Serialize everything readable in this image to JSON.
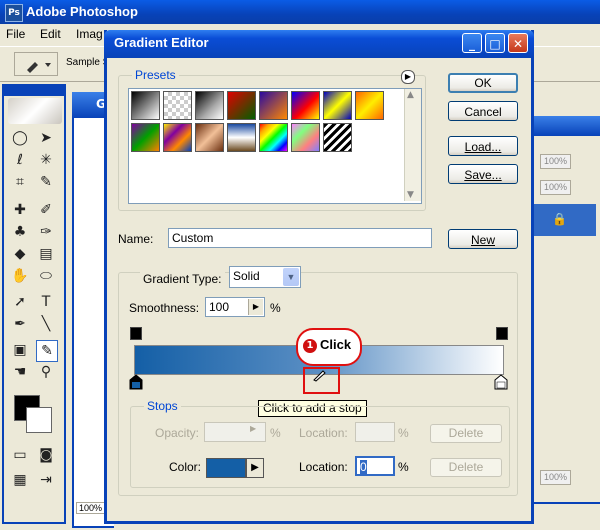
{
  "app": {
    "title": "Adobe Photoshop",
    "logo": "Ps"
  },
  "menu": [
    "File",
    "Edit",
    "Imag"
  ],
  "options_bar": {
    "sample_label": "Sample S"
  },
  "doc_window": {
    "title": "G",
    "zoom": "100%"
  },
  "palette": {
    "fields": [
      "100%",
      "100%",
      "100%"
    ]
  },
  "dialog": {
    "title": "Gradient Editor",
    "title_buttons": {
      "minimize": "_",
      "maximize": "□",
      "close": "✕"
    },
    "presets": {
      "label": "Presets",
      "swatches": [
        {
          "name": "black-white",
          "css": "linear-gradient(135deg,#000,#fff)"
        },
        {
          "name": "transparent-checker",
          "css": "repeating-conic-gradient(#ccc 0 25%,#fff 0 50%) 0 0/8px 8px"
        },
        {
          "name": "black-white-2",
          "css": "linear-gradient(135deg,#000,#aaa 60%,#fff)"
        },
        {
          "name": "red-green",
          "css": "linear-gradient(135deg,#e00000,#006000)"
        },
        {
          "name": "violet-orange",
          "css": "linear-gradient(135deg,#2a0aa0,#ff8800)"
        },
        {
          "name": "blue-red-yellow",
          "css": "linear-gradient(135deg,#0000ff,#ff0000 55%,#ffff00)"
        },
        {
          "name": "blue-yellow-blue",
          "css": "linear-gradient(135deg,#0000c0,#ffff00 50%,#0000c0)"
        },
        {
          "name": "orange-yellow-orange",
          "css": "linear-gradient(135deg,#ff6600,#ffee00 50%,#ff6600)"
        },
        {
          "name": "violet-green-orange",
          "css": "linear-gradient(135deg,#8000a0,#00a000 50%,#ff8000)"
        },
        {
          "name": "yellow-violet-orange-blue",
          "css": "linear-gradient(135deg,#ffee00,#8000a0 35%,#ff8800 65%,#0040c0)"
        },
        {
          "name": "copper",
          "css": "linear-gradient(135deg,#6b2f10,#f2c098 50%,#6b2f10)"
        },
        {
          "name": "chrome",
          "css": "linear-gradient(180deg,#1a4aa0,#fff 50%,#6b4a20)"
        },
        {
          "name": "spectrum",
          "css": "linear-gradient(135deg,red,orange,yellow,lime,cyan,blue,magenta)"
        },
        {
          "name": "transparent-rainbow",
          "css": "linear-gradient(135deg,#ff80ff,#80ff80,#ff8080,#8080ff)"
        },
        {
          "name": "transparent-stripes",
          "css": "repeating-linear-gradient(135deg,#000 0 3px,#fff 3px 6px)"
        }
      ]
    },
    "buttons": {
      "ok": "OK",
      "cancel": "Cancel",
      "load": "Load...",
      "save": "Save...",
      "new": "New"
    },
    "name_label": "Name:",
    "name_value": "Custom",
    "gradient_type_label": "Gradient Type:",
    "gradient_type_value": "Solid",
    "smoothness_label": "Smoothness:",
    "smoothness_value": "100",
    "smoothness_unit": "%",
    "gradient_colors": {
      "start": "#145fa6",
      "mid": "#5b8fc4",
      "end": "#ffffff"
    },
    "annotation": {
      "number": "1",
      "text": "Click"
    },
    "tooltip": "Click to add a stop",
    "stops": {
      "label": "Stops",
      "opacity_label": "Opacity:",
      "opacity_value": "",
      "opacity_unit": "%",
      "location_label_1": "Location:",
      "location_value_1": "",
      "location_unit_1": "%",
      "delete_label_1": "Delete",
      "color_label": "Color:",
      "color_value": "#145fa6",
      "location_label_2": "Location:",
      "location_value_2": "0",
      "location_unit_2": "%",
      "delete_label_2": "Delete"
    }
  }
}
